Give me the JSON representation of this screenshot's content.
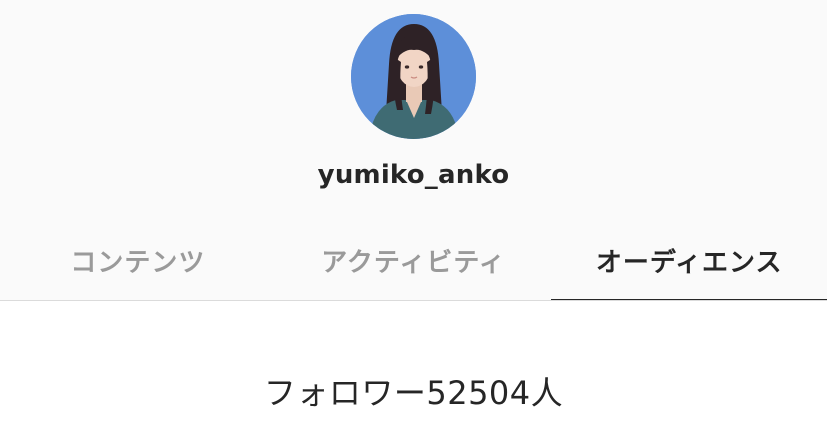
{
  "profile": {
    "username": "yumiko_anko",
    "avatar_icon": "profile-photo"
  },
  "tabs": [
    {
      "label": "コンテンツ",
      "active": false
    },
    {
      "label": "アクティビティ",
      "active": false
    },
    {
      "label": "オーディエンス",
      "active": true
    }
  ],
  "audience": {
    "followers_text": "フォロワー52504人"
  },
  "colors": {
    "header_bg": "#fafafa",
    "active_text": "#262626",
    "inactive_text": "#9a9a9a",
    "avatar_bg": "#5d8fd9"
  }
}
